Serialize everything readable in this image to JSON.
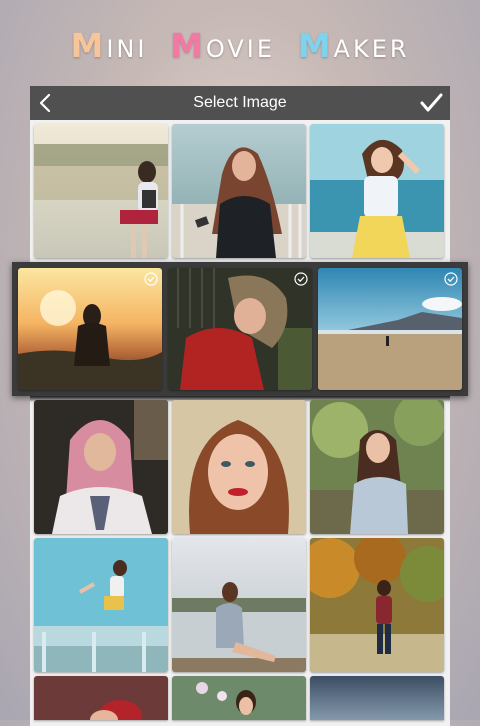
{
  "app": {
    "title_words": [
      {
        "cap": "M",
        "rest": "INI"
      },
      {
        "cap": "M",
        "rest": "OVIE"
      },
      {
        "cap": "M",
        "rest": "AKER"
      }
    ]
  },
  "header": {
    "title": "Select Image",
    "back_icon": "chevron-left-icon",
    "done_icon": "checkmark-icon"
  },
  "colors": {
    "title_cap_1": "#f6c59a",
    "title_cap_2": "#f07aa3",
    "title_cap_3": "#7fd3ee",
    "toolbar_bg": "#505050",
    "selected_strip_bg": "#3b3b3b"
  },
  "gallery": {
    "selected_count_visible": 3,
    "images": [
      {
        "subject": "girl-with-backpack-by-lake",
        "selected": false
      },
      {
        "subject": "woman-with-phone-by-sea",
        "selected": false
      },
      {
        "subject": "girl-in-yellow-skirt-on-beach",
        "selected": false
      },
      {
        "subject": "woman-silhouette-at-sunset",
        "selected": true
      },
      {
        "subject": "woman-in-red-top-with-glasses",
        "selected": true
      },
      {
        "subject": "person-walking-on-beach",
        "selected": true
      },
      {
        "subject": "woman-in-pink-hijab",
        "selected": false
      },
      {
        "subject": "woman-portrait-red-lips",
        "selected": false
      },
      {
        "subject": "woman-in-park-smiling",
        "selected": false
      },
      {
        "subject": "girl-jumping-by-sea",
        "selected": false
      },
      {
        "subject": "woman-sitting-on-pier",
        "selected": false
      },
      {
        "subject": "woman-walking-in-autumn-woods",
        "selected": false
      },
      {
        "subject": "woman-with-red-flowers",
        "selected": false
      },
      {
        "subject": "woman-among-flowers",
        "selected": false
      },
      {
        "subject": "sea-at-dusk",
        "selected": false
      }
    ]
  }
}
